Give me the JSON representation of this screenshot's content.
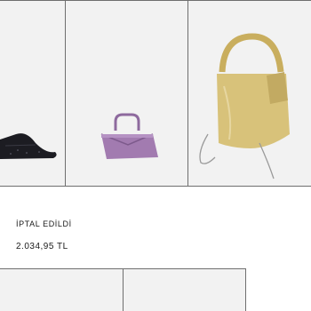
{
  "order": {
    "status": "İPTAL EDİLDİ",
    "total": "2.034,95 TL"
  },
  "products": [
    {
      "name": "shoe-image",
      "kind": "black sparkly pointed flat shoe"
    },
    {
      "name": "purple-bag-image",
      "kind": "purple glitter mini handbag"
    },
    {
      "name": "gold-bag-image",
      "kind": "gold metallic bucket bag with chain"
    }
  ],
  "colors": {
    "tile_bg": "#f2f2f2",
    "divider": "#6f6f6f",
    "text": "#1a1a1a",
    "gold": "#d8c27a",
    "purple": "#a27bb0",
    "shoe": "#1c1c22"
  }
}
